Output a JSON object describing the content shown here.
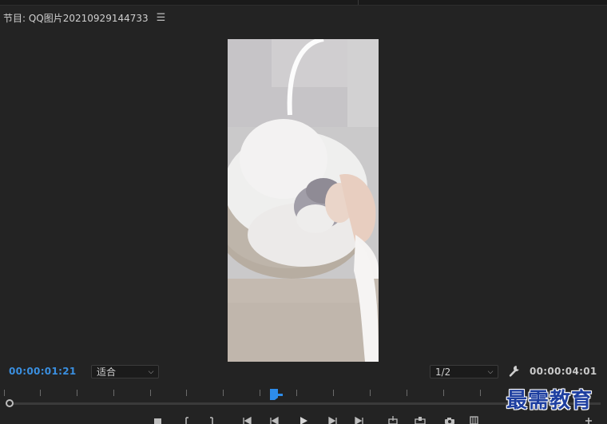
{
  "panel": {
    "title": "节目: QQ图片20210929144733",
    "menu_icon": "☰"
  },
  "viewer": {
    "subject": "cat-in-basket-photo"
  },
  "controls": {
    "current_timecode": "00:00:01:21",
    "total_timecode": "00:00:04:01",
    "zoom_select": {
      "value": "适合",
      "arrow": "⌵"
    },
    "resolution_select": {
      "value": "1/2",
      "arrow": "⌵"
    },
    "settings_icon": "wrench-icon"
  },
  "timeline": {
    "playhead_position": 0.45,
    "accent_color": "#2d8ceb"
  },
  "transport_buttons": [
    "add-marker",
    "mark-in",
    "mark-out",
    "go-to-in",
    "step-back",
    "play",
    "step-forward",
    "go-to-out",
    "insert",
    "overwrite",
    "export-frame",
    "comparison-view",
    "button-editor"
  ],
  "watermark": "最需教育"
}
